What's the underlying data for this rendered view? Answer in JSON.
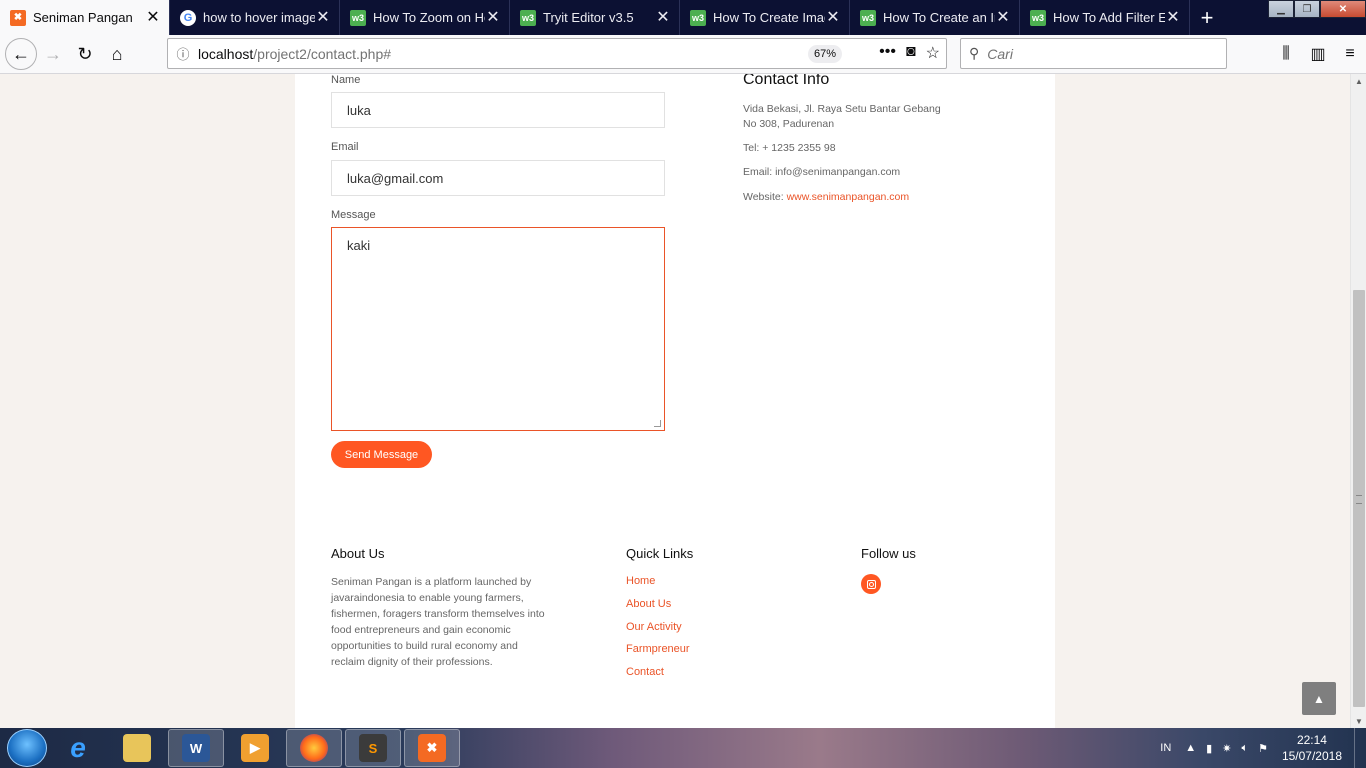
{
  "browser": {
    "tabs": [
      {
        "title": "Seniman Pangan",
        "favicon": "xampp-icon",
        "active": true
      },
      {
        "title": "how to hover image",
        "favicon": "google-icon",
        "active": false
      },
      {
        "title": "How To Zoom on Ho",
        "favicon": "w3schools-icon",
        "active": false
      },
      {
        "title": "Tryit Editor v3.5",
        "favicon": "w3schools-icon",
        "active": false
      },
      {
        "title": "How To Create Imag",
        "favicon": "w3schools-icon",
        "active": false
      },
      {
        "title": "How To Create an Im",
        "favicon": "w3schools-icon",
        "active": false
      },
      {
        "title": "How To Add Filter Ef",
        "favicon": "w3schools-icon",
        "active": false
      }
    ],
    "new_tab": "+",
    "url_host": "localhost",
    "url_path": "/project2/contact.php#",
    "zoom": "67%",
    "search_placeholder": "Cari"
  },
  "form": {
    "name_label": "Name",
    "name_value": "luka",
    "email_label": "Email",
    "email_value": "luka@gmail.com",
    "message_label": "Message",
    "message_value": "kaki",
    "send_label": "Send Message"
  },
  "contact_info": {
    "heading": "Contact Info",
    "address_line1": "Vida Bekasi, Jl. Raya Setu Bantar Gebang",
    "address_line2": "No 308, Padurenan",
    "tel": "Tel: + 1235 2355 98",
    "email": "Email: info@senimanpangan.com",
    "website_label": "Website: ",
    "website_link": "www.senimanpangan.com"
  },
  "footer": {
    "about_heading": "About Us",
    "about_text": "Seniman Pangan is a platform launched by javaraindonesia to enable young farmers, fishermen, foragers transform themselves into food entrepreneurs and gain economic opportunities to build rural economy and reclaim dignity of their professions.",
    "links_heading": "Quick Links",
    "links": [
      "Home",
      "About Us",
      "Our Activity",
      "Farmpreneur",
      "Contact"
    ],
    "follow_heading": "Follow us"
  },
  "taskbar": {
    "apps": [
      "internet-explorer",
      "file-explorer",
      "word",
      "media-player",
      "firefox",
      "sublime-text",
      "xampp"
    ],
    "lang": "IN",
    "time": "22:14",
    "date": "15/07/2018"
  },
  "colors": {
    "accent": "#ff5722",
    "link": "#ea5428",
    "tab_strip": "#0c1133"
  }
}
